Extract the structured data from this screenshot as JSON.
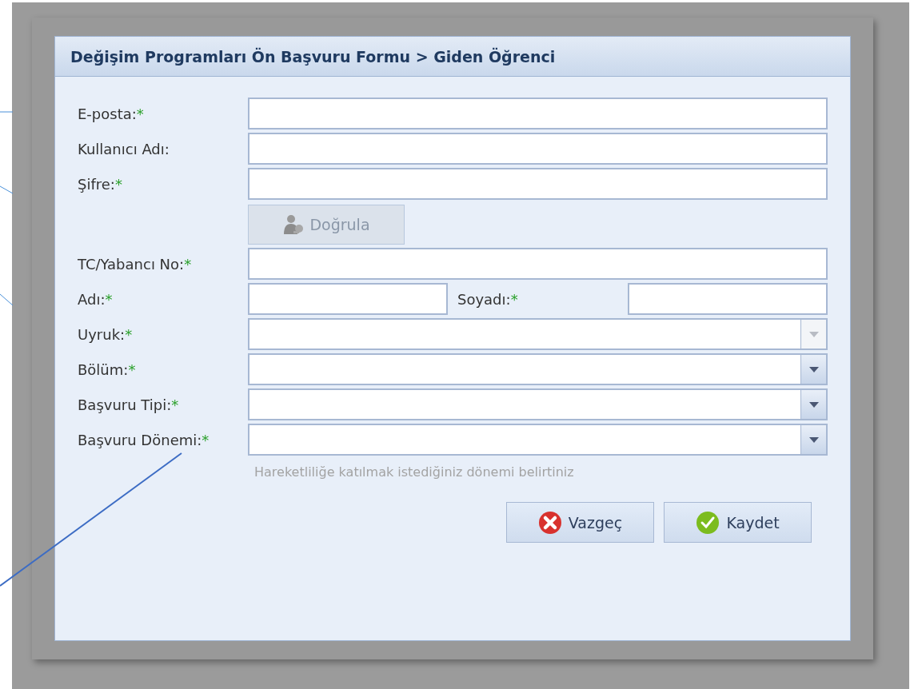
{
  "dialog": {
    "title": "Değişim Programları Ön Başvuru Formu > Giden Öğrenci"
  },
  "required_mark": "*",
  "fields": [
    {
      "kind": "text",
      "label": "E-posta:",
      "required": true
    },
    {
      "kind": "text",
      "label": "Kullanıcı Adı:",
      "required": false
    },
    {
      "kind": "text",
      "label": "Şifre:",
      "required": true
    },
    {
      "kind": "button",
      "label": "Doğrula",
      "disabled": true
    },
    {
      "kind": "text",
      "label": "TC/Yabancı No:",
      "required": true
    },
    {
      "kind": "pair",
      "label": "Adı:",
      "required": true,
      "label2": "Soyadı:",
      "required2": true
    },
    {
      "kind": "combo",
      "label": "Uyruk:",
      "required": true,
      "disabled": true
    },
    {
      "kind": "combo",
      "label": "Bölüm:",
      "required": true,
      "disabled": false
    },
    {
      "kind": "combo",
      "label": "Başvuru Tipi:",
      "required": true,
      "disabled": false
    },
    {
      "kind": "combo",
      "label": "Başvuru Dönemi:",
      "required": true,
      "disabled": false,
      "hint": "Hareketliliğe katılmak istediğiniz dönemi belirtiniz"
    }
  ],
  "buttons": [
    {
      "kind": "cancel",
      "label": "Vazgeç"
    },
    {
      "kind": "save",
      "label": "Kaydet"
    }
  ]
}
